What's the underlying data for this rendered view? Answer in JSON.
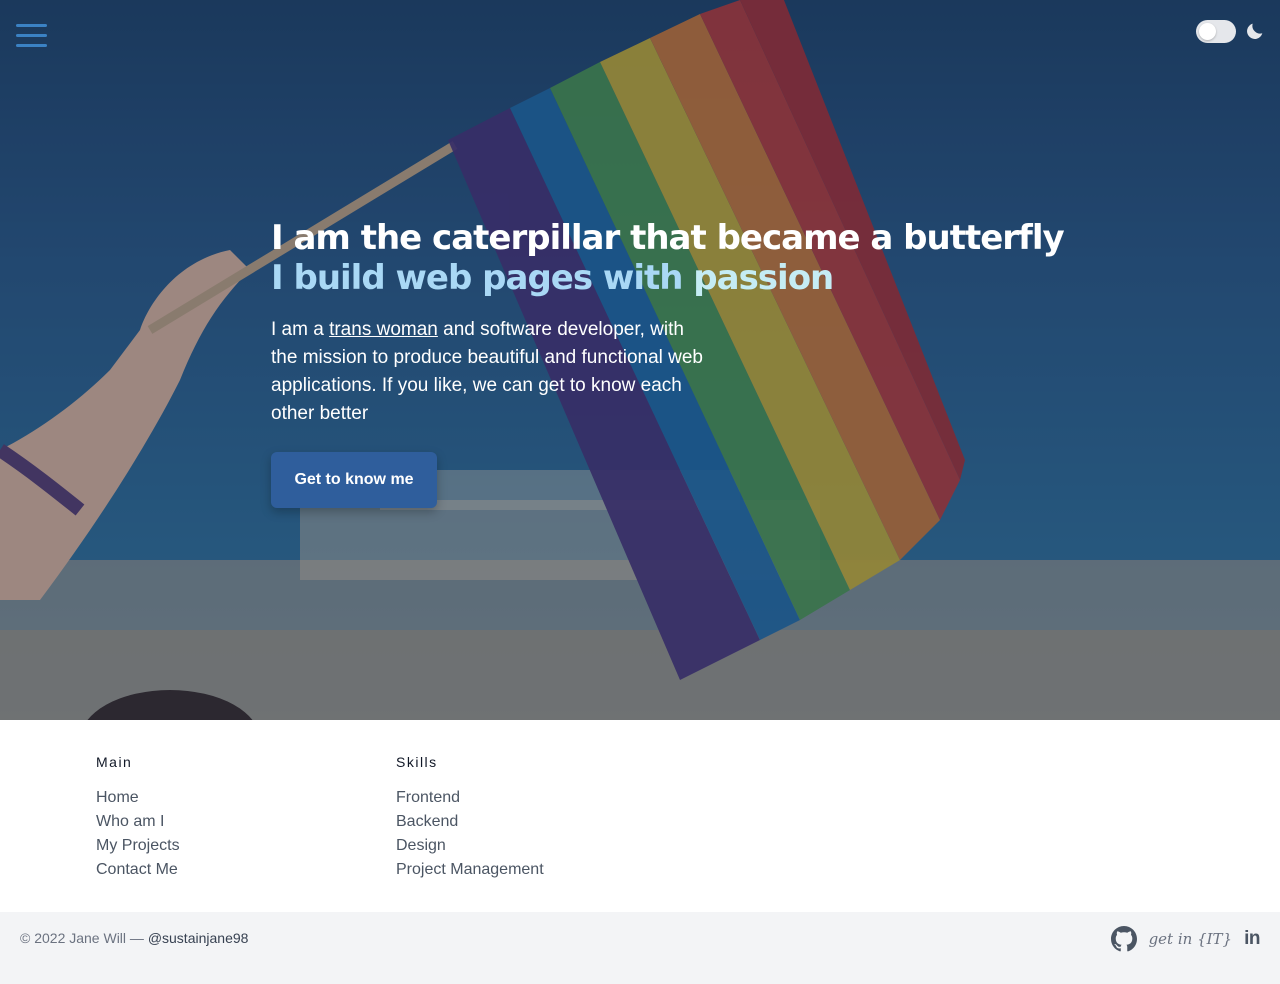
{
  "header": {
    "menu_icon": "hamburger-menu-icon",
    "theme_toggle_icon": "moon-icon"
  },
  "hero": {
    "title": "I am the caterpillar that became a butterfly",
    "subtitle_part1": "I build web pages with ",
    "subtitle_part2": "passion",
    "intro_before": "I am a ",
    "intro_link": "trans woman",
    "intro_after": " and software developer, with the mission to produce beautiful and functional web applications. If you like, we can get to know each other better",
    "cta_label": "Get to know me"
  },
  "footer": {
    "columns": [
      {
        "title": "Main",
        "items": [
          "Home",
          "Who am I",
          "My Projects",
          "Contact Me"
        ]
      },
      {
        "title": "Skills",
        "items": [
          "Frontend",
          "Backend",
          "Design",
          "Project Management"
        ]
      }
    ],
    "copyright": "© 2022 Jane Will — ",
    "handle": "@sustainjane98",
    "socials": {
      "github_icon": "github-icon",
      "getin_label": "get in {IT}",
      "linkedin_label": "in"
    }
  },
  "colors": {
    "accent": "#2f5e9c",
    "subtitle_blue": "#a9d8f5",
    "subtitle_cyan": "#c5ecf4",
    "menu_blue": "#3b82c4"
  }
}
